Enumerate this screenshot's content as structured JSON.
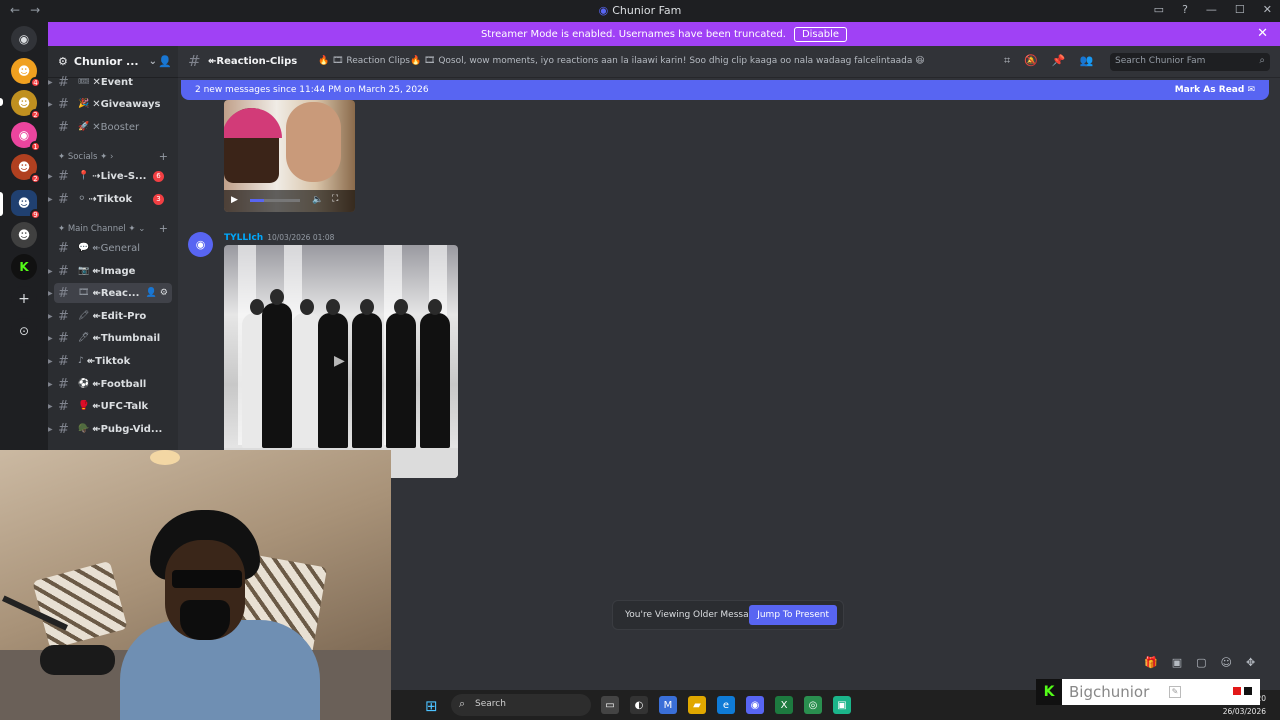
{
  "window": {
    "title": "Chunior Fam",
    "nav_back": "←",
    "nav_fwd": "→",
    "controls": [
      "▭",
      "?",
      "—",
      "☐",
      "✕"
    ]
  },
  "banner": {
    "text": "Streamer Mode is enabled. Usernames have been truncated.",
    "button": "Disable",
    "close": "✕"
  },
  "server_rail": {
    "items": [
      {
        "icon": "discord-home-icon",
        "glyph": "⌂",
        "color": "#1e1f22"
      },
      {
        "icon": "server-avatar",
        "glyph": "☻",
        "color": "#f0a020",
        "badge": "4"
      },
      {
        "icon": "server-avatar",
        "glyph": "☻",
        "color": "#c09020",
        "badge": "2"
      },
      {
        "icon": "server-avatar",
        "glyph": "☻",
        "color": "#eb459e",
        "badge": "1"
      },
      {
        "icon": "server-avatar",
        "glyph": "☻",
        "color": "#b04020",
        "badge": "2"
      },
      {
        "icon": "server-avatar",
        "glyph": "☻",
        "color": "#204070",
        "badge": "9"
      },
      {
        "icon": "server-avatar",
        "glyph": "☻",
        "color": "#404040",
        "badge": ""
      },
      {
        "icon": "server-avatar",
        "glyph": "K",
        "color": "#111111",
        "badge": ""
      },
      {
        "icon": "add-server-icon",
        "glyph": "+",
        "color": "#1e1f22",
        "badge": ""
      },
      {
        "icon": "explore-icon",
        "glyph": "⊙",
        "color": "#1e1f22",
        "badge": ""
      }
    ]
  },
  "sidebar": {
    "server_name": "Chunior ...",
    "server_icon": "⚙",
    "chevron": "⌄",
    "invite_icon": "👤",
    "channels_top": [
      {
        "emoji": "🎟",
        "name": "✕Event",
        "dim": false
      },
      {
        "emoji": "🎉",
        "name": "✕Giveaways",
        "dim": false
      },
      {
        "emoji": "🚀",
        "name": "✕Booster",
        "dim": true
      }
    ],
    "category_socials": "✦ Socials ✦",
    "socials": [
      {
        "emoji": "📍",
        "name": "⇢Live-S...",
        "count": "6"
      },
      {
        "emoji": "⚪",
        "name": "⇢Tiktok",
        "count": "3"
      }
    ],
    "category_main": "✦ Main Channel ✦",
    "main": [
      {
        "emoji": "💬",
        "name": "↞General",
        "dim": true
      },
      {
        "emoji": "📷",
        "name": "↞Image",
        "dim": false
      },
      {
        "emoji": "🎞",
        "name": "↞Reac...",
        "dim": false,
        "active": true
      },
      {
        "emoji": "🖍",
        "name": "↞Edit-Pro",
        "dim": false
      },
      {
        "emoji": "🖊",
        "name": "↞Thumbnail",
        "dim": false
      },
      {
        "emoji": "♪",
        "name": "↞Tiktok",
        "dim": false
      },
      {
        "emoji": "⚽",
        "name": "↞Football",
        "dim": false
      },
      {
        "emoji": "🥊",
        "name": "↞UFC-Talk",
        "dim": false
      },
      {
        "emoji": "🪖",
        "name": "↞Pubg-Vid...",
        "dim": false
      }
    ]
  },
  "header": {
    "channel": "↞Reaction-Clips",
    "topic": "🔥 🎞 Reaction Clips🔥 🎞 Qosol, wow moments, iyo reactions aan la ilaawi karin! Soo dhig clip kaaga oo nala wadaag falcelintaada 😆",
    "search_placeholder": "Search Chunior Fam"
  },
  "newbar": {
    "text": "2 new messages since 11:44 PM on March 25, 2026",
    "mark": "Mark As Read"
  },
  "message": {
    "author": "TYLLIch",
    "timestamp": "10/03/2026 01:08"
  },
  "older": {
    "text": "You're Viewing Older Messages",
    "button": "Jump To Present"
  },
  "taskbar": {
    "search": "Search",
    "time": "20",
    "date": "26/03/2026"
  },
  "overlay": {
    "logo": "K",
    "name": "Bigchunior"
  }
}
